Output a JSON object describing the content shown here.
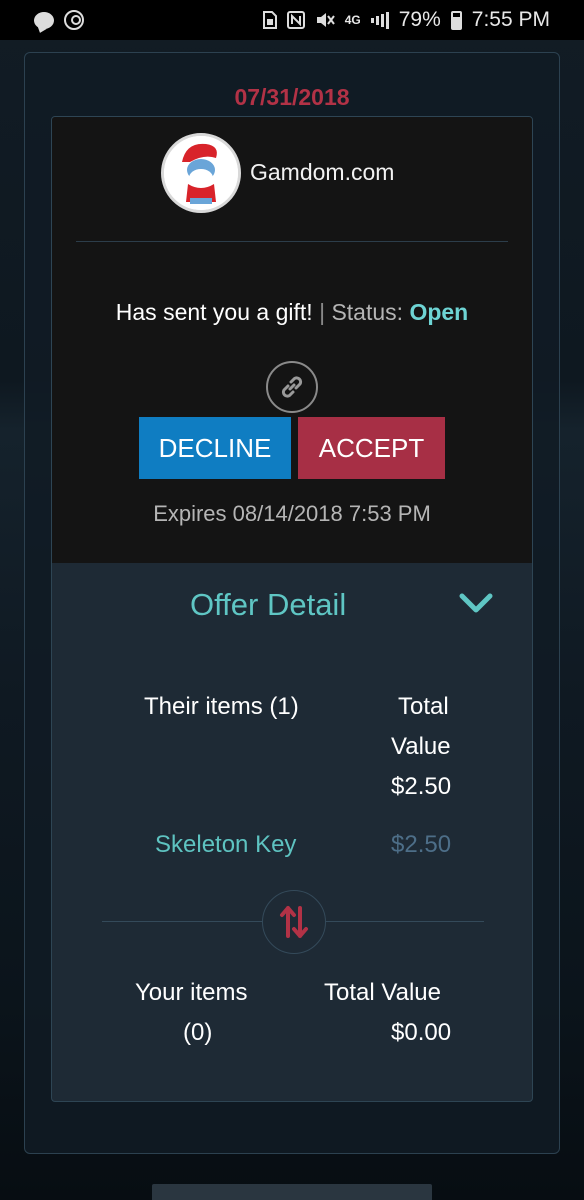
{
  "status_bar": {
    "battery_percent": "79%",
    "time": "7:55 PM",
    "network": "4G"
  },
  "gift": {
    "date": "07/31/2018",
    "sender": "Gamdom.com",
    "message": "Has sent you a gift!",
    "separator": "|",
    "status_label": "Status:",
    "status_value": "Open",
    "decline_label": "DECLINE",
    "accept_label": "ACCEPT",
    "expires": "Expires 08/14/2018 7:53 PM"
  },
  "offer": {
    "title": "Offer Detail",
    "their_items_label": "Their items (1)",
    "their_total_line1": "Total",
    "their_total_line2": "Value",
    "their_total_value": "$2.50",
    "items": [
      {
        "name": "Skeleton Key",
        "price": "$2.50"
      }
    ],
    "your_items_line1": "Your items",
    "your_items_line2": "(0)",
    "your_total_label": "Total Value",
    "your_total_value": "$0.00"
  },
  "colors": {
    "accent_teal": "#5fc6c4",
    "decline_blue": "#0f7dc2",
    "accept_red": "#a72f45",
    "date_red": "#b23246"
  }
}
